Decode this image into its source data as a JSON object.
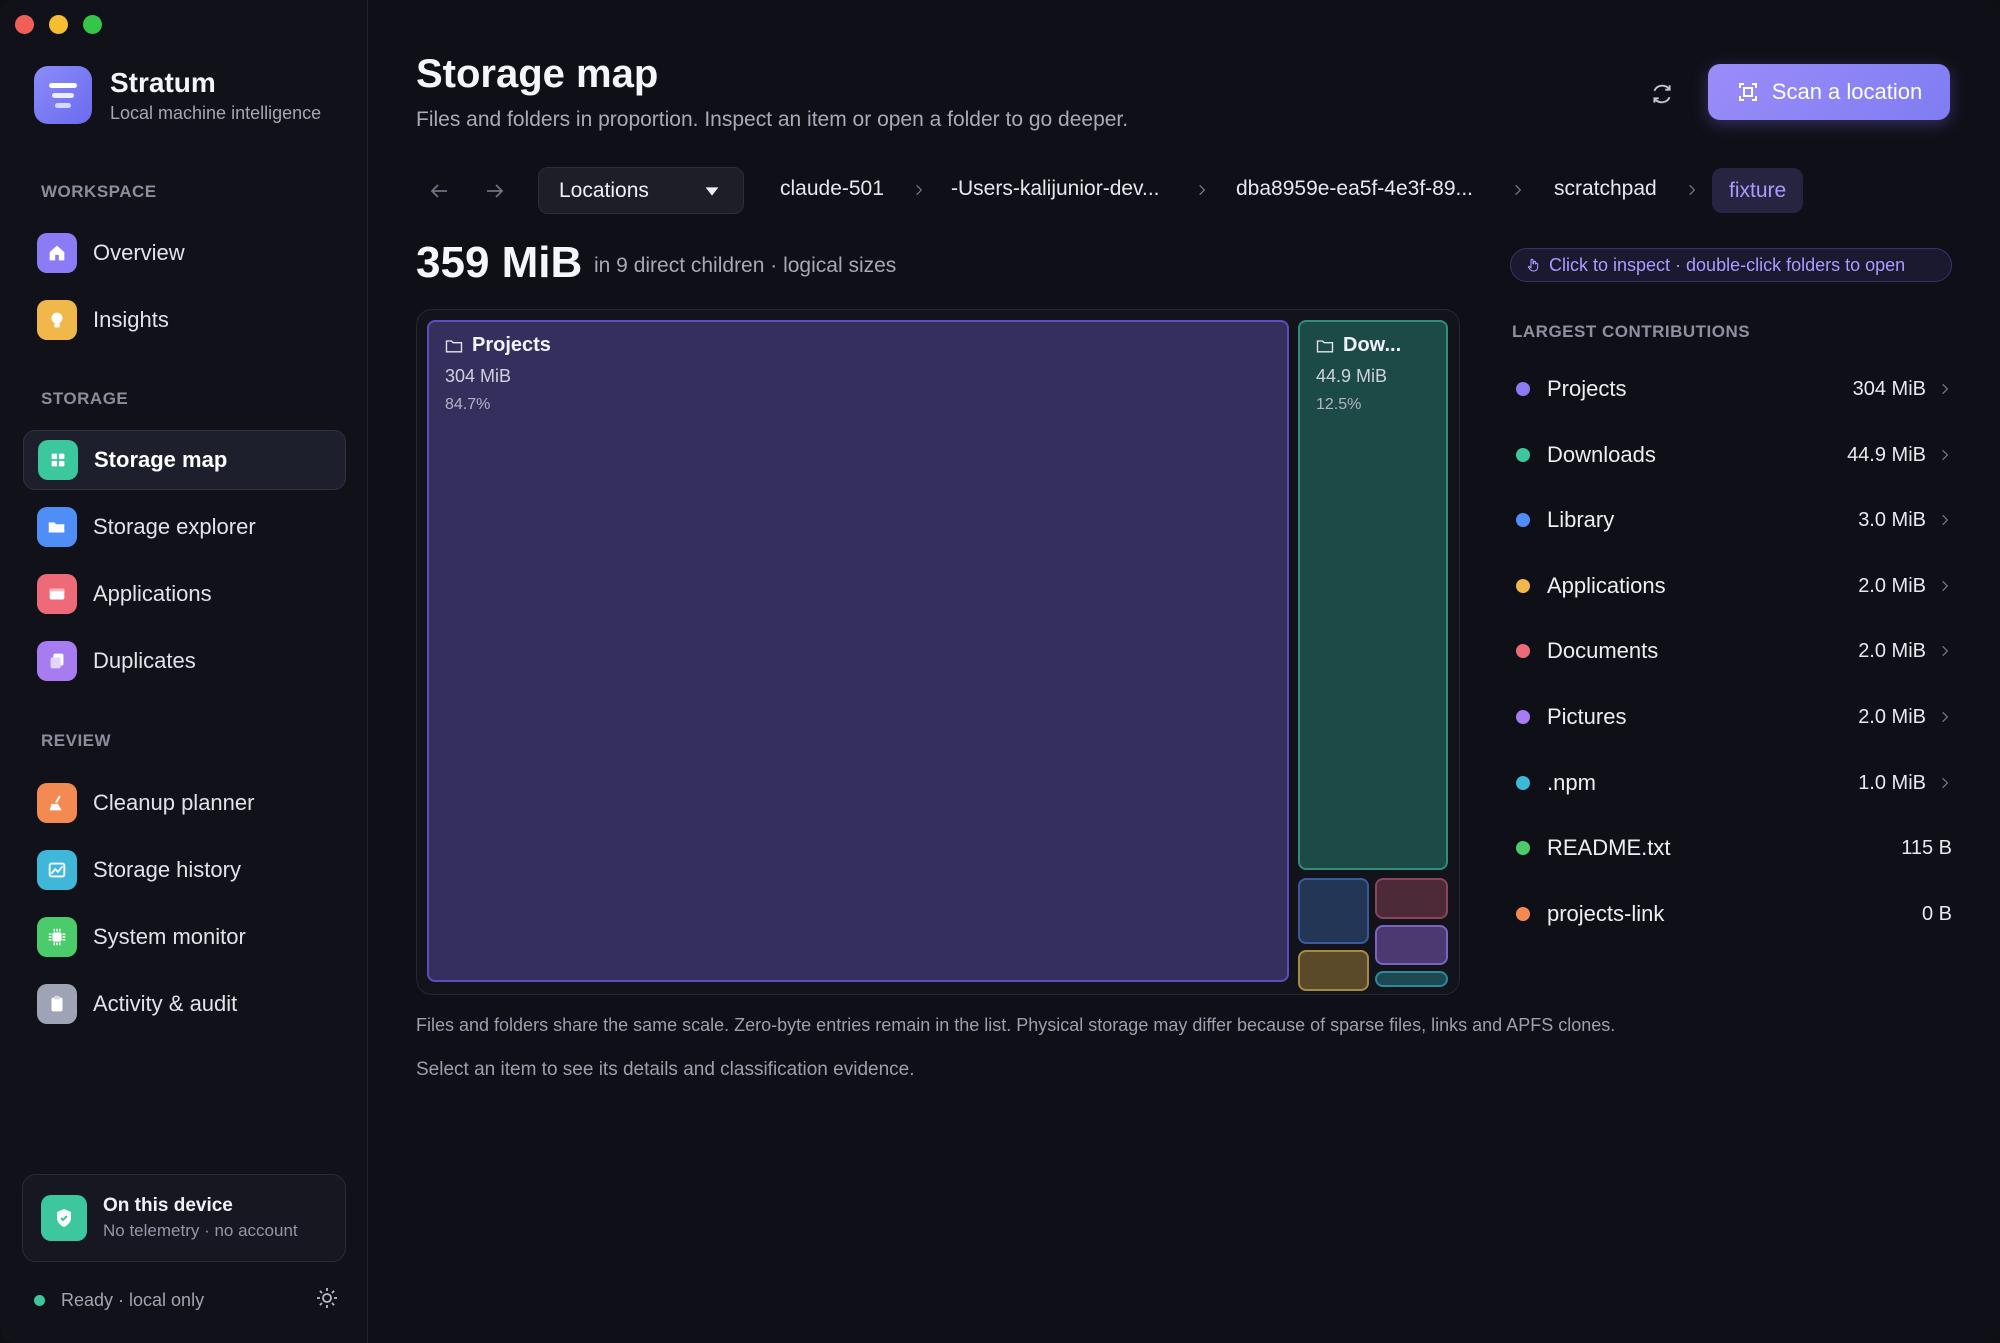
{
  "brand": {
    "name": "Stratum",
    "subtitle": "Local machine intelligence"
  },
  "sidebar": {
    "sections": [
      {
        "label": "WORKSPACE",
        "items": [
          {
            "label": "Overview",
            "icon": "home-icon",
            "color": "#8b7cf6"
          },
          {
            "label": "Insights",
            "icon": "lightbulb-icon",
            "color": "#f0b74a"
          }
        ]
      },
      {
        "label": "STORAGE",
        "items": [
          {
            "label": "Storage map",
            "icon": "grid-icon",
            "color": "#3cc79e",
            "active": true
          },
          {
            "label": "Storage explorer",
            "icon": "folder-open-icon",
            "color": "#4f8ef7"
          },
          {
            "label": "Applications",
            "icon": "window-icon",
            "color": "#ee6a78"
          },
          {
            "label": "Duplicates",
            "icon": "copy-icon",
            "color": "#a77cf0"
          }
        ]
      },
      {
        "label": "REVIEW",
        "items": [
          {
            "label": "Cleanup planner",
            "icon": "broom-icon",
            "color": "#f28a52"
          },
          {
            "label": "Storage history",
            "icon": "chart-icon",
            "color": "#3fb7d8"
          },
          {
            "label": "System monitor",
            "icon": "chip-icon",
            "color": "#4ccb6c"
          },
          {
            "label": "Activity & audit",
            "icon": "clipboard-icon",
            "color": "#9ea3b5"
          }
        ]
      }
    ],
    "device": {
      "title": "On this device",
      "subtitle": "No telemetry · no account"
    },
    "status": "Ready · local only"
  },
  "header": {
    "title": "Storage map",
    "subtitle": "Files and folders in proportion. Inspect an item or open a folder to go deeper.",
    "scan_label": "Scan a location"
  },
  "breadcrumb": {
    "locations_label": "Locations",
    "items": [
      "claude-501",
      "-Users-kalijunior-dev...",
      "dba8959e-ea5f-4e3f-89...",
      "scratchpad"
    ],
    "current": "fixture"
  },
  "summary": {
    "total": "359 MiB",
    "detail": "in 9 direct children · logical sizes",
    "hint": "Click to inspect · double-click folders to open"
  },
  "treemap": {
    "tiles": [
      {
        "name": "Projects",
        "size": "304 MiB",
        "percent": "84.7%",
        "color": "#352f5e",
        "border": "#5a4ec0"
      },
      {
        "name": "Dow...",
        "size": "44.9 MiB",
        "percent": "12.5%",
        "color": "#1c4a47",
        "border": "#2f8d79"
      }
    ]
  },
  "contributions": {
    "title": "LARGEST CONTRIBUTIONS",
    "rows": [
      {
        "name": "Projects",
        "value": "304 MiB",
        "color": "#8b7cf6",
        "chevron": true
      },
      {
        "name": "Downloads",
        "value": "44.9 MiB",
        "color": "#3cc79e",
        "chevron": true
      },
      {
        "name": "Library",
        "value": "3.0 MiB",
        "color": "#4f8ef7",
        "chevron": true
      },
      {
        "name": "Applications",
        "value": "2.0 MiB",
        "color": "#f0b74a",
        "chevron": true
      },
      {
        "name": "Documents",
        "value": "2.0 MiB",
        "color": "#ee6a78",
        "chevron": true
      },
      {
        "name": "Pictures",
        "value": "2.0 MiB",
        "color": "#a77cf0",
        "chevron": true
      },
      {
        "name": ".npm",
        "value": "1.0 MiB",
        "color": "#3fb7d8",
        "chevron": true
      },
      {
        "name": "README.txt",
        "value": "115 B",
        "color": "#4ccb6c",
        "chevron": false
      },
      {
        "name": "projects-link",
        "value": "0 B",
        "color": "#f28a52",
        "chevron": false
      }
    ]
  },
  "footnotes": {
    "line1": "Files and folders share the same scale. Zero-byte entries remain in the list. Physical storage may differ because of sparse files, links and APFS clones.",
    "line2": "Select an item to see its details and classification evidence."
  }
}
